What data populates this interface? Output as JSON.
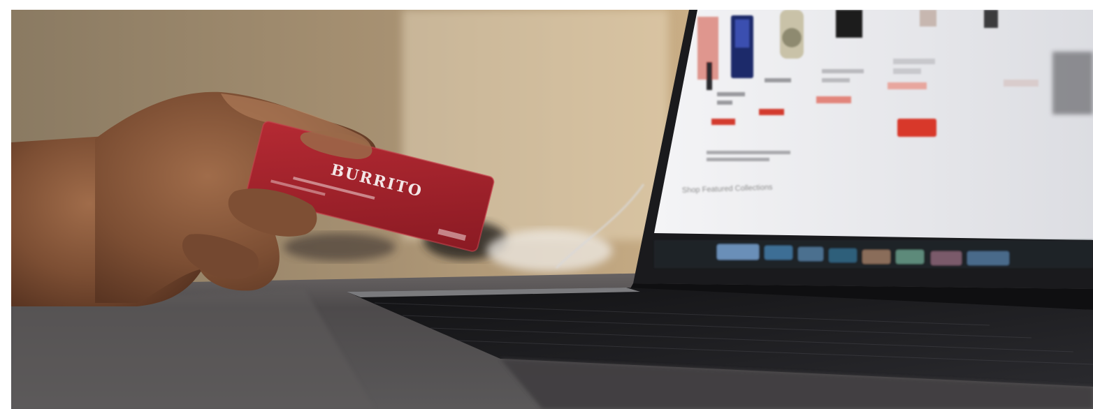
{
  "photo": {
    "subject": "online-shopping-photo",
    "card_brand_text": "BURRITO",
    "laptop_screen_heading": "Shop Featured Collections",
    "colors": {
      "card_red": "#a2222c",
      "laptop_dark": "#1e1e22",
      "screen_bg": "#e9eaee",
      "price_red": "#d33a2e",
      "wall_tan": "#b59a76",
      "desk_gray": "#4d4b4c"
    }
  }
}
